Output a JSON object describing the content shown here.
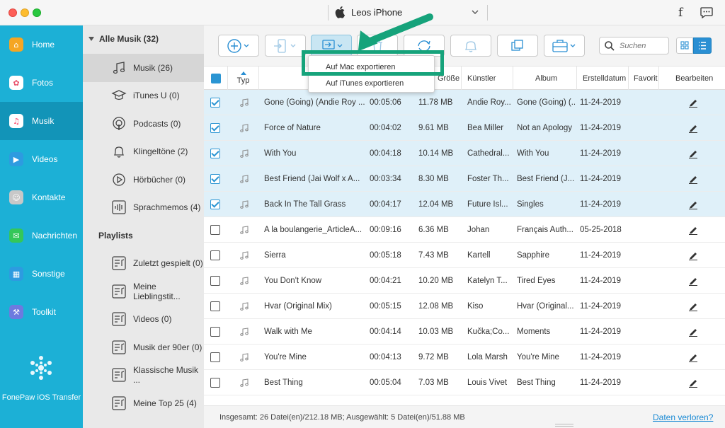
{
  "window": {
    "device_name": "Leos iPhone"
  },
  "sidebar": {
    "items": [
      {
        "label": "Home",
        "icon": "home-icon",
        "color": "#f5a623"
      },
      {
        "label": "Fotos",
        "icon": "photos-icon",
        "color": "#e94f6a"
      },
      {
        "label": "Musik",
        "icon": "music-icon",
        "color": "#fc3158",
        "active": true
      },
      {
        "label": "Videos",
        "icon": "videos-icon",
        "color": "#2d9be0"
      },
      {
        "label": "Kontakte",
        "icon": "contacts-icon",
        "color": "#b0b0b0"
      },
      {
        "label": "Nachrichten",
        "icon": "messages-icon",
        "color": "#34c759"
      },
      {
        "label": "Sonstige",
        "icon": "other-icon",
        "color": "#2d9be0"
      },
      {
        "label": "Toolkit",
        "icon": "toolkit-icon",
        "color": "#6d7adf"
      }
    ],
    "brand": "FonePaw iOS Transfer"
  },
  "categories": {
    "header": "Alle Musik (32)",
    "items": [
      {
        "label": "Musik (26)",
        "icon": "music-note-icon",
        "active": true
      },
      {
        "label": "iTunes U (0)",
        "icon": "itunes-u-icon"
      },
      {
        "label": "Podcasts (0)",
        "icon": "podcast-icon"
      },
      {
        "label": "Klingeltöne (2)",
        "icon": "bell-icon"
      },
      {
        "label": "Hörbücher (0)",
        "icon": "audiobook-icon"
      },
      {
        "label": "Sprachmemos (4)",
        "icon": "voice-memo-icon"
      }
    ],
    "playlists_header": "Playlists",
    "playlists": [
      {
        "label": "Zuletzt gespielt (0)"
      },
      {
        "label": "Meine Lieblingstit..."
      },
      {
        "label": "Videos (0)"
      },
      {
        "label": "Musik der 90er (0)"
      },
      {
        "label": "Klassische Musik ..."
      },
      {
        "label": "Meine Top 25 (4)"
      }
    ]
  },
  "toolbar": {
    "search_placeholder": "Suchen",
    "export_menu": [
      "Auf Mac exportieren",
      "Auf iTunes exportieren"
    ]
  },
  "table": {
    "columns": [
      "Typ",
      "Größe",
      "Künstler",
      "Album",
      "Erstelldatum",
      "Favorit",
      "Bearbeiten"
    ],
    "rows": [
      {
        "checked": true,
        "name": "Gone (Going) (Andie Roy ...",
        "duration": "00:05:06",
        "size": "11.78 MB",
        "artist": "Andie Roy...",
        "album": "Gone (Going) (...",
        "date": "11-24-2019"
      },
      {
        "checked": true,
        "name": "Force of Nature",
        "duration": "00:04:02",
        "size": "9.61 MB",
        "artist": "Bea Miller",
        "album": "Not an Apology",
        "date": "11-24-2019"
      },
      {
        "checked": true,
        "name": "With You",
        "duration": "00:04:18",
        "size": "10.14 MB",
        "artist": "Cathedral...",
        "album": "With You",
        "date": "11-24-2019"
      },
      {
        "checked": true,
        "name": "Best Friend (Jai Wolf x A...",
        "duration": "00:03:34",
        "size": "8.30 MB",
        "artist": "Foster Th...",
        "album": "Best Friend (J...",
        "date": "11-24-2019"
      },
      {
        "checked": true,
        "name": "Back In The Tall Grass",
        "duration": "00:04:17",
        "size": "12.04 MB",
        "artist": "Future Isl...",
        "album": "Singles",
        "date": "11-24-2019"
      },
      {
        "checked": false,
        "name": "A la boulangerie_ArticleA...",
        "duration": "00:09:16",
        "size": "6.36 MB",
        "artist": "Johan",
        "album": "Français Auth...",
        "date": "05-25-2018"
      },
      {
        "checked": false,
        "name": "Sierra",
        "duration": "00:05:18",
        "size": "7.43 MB",
        "artist": "Kartell",
        "album": "Sapphire",
        "date": "11-24-2019"
      },
      {
        "checked": false,
        "name": "You Don't Know",
        "duration": "00:04:21",
        "size": "10.20 MB",
        "artist": "Katelyn T...",
        "album": "Tired Eyes",
        "date": "11-24-2019"
      },
      {
        "checked": false,
        "name": "Hvar (Original Mix)",
        "duration": "00:05:15",
        "size": "12.08 MB",
        "artist": "Kiso",
        "album": "Hvar (Original...",
        "date": "11-24-2019"
      },
      {
        "checked": false,
        "name": "Walk with Me",
        "duration": "00:04:14",
        "size": "10.03 MB",
        "artist": "Kučka;Co...",
        "album": "Moments",
        "date": "11-24-2019"
      },
      {
        "checked": false,
        "name": "You're Mine",
        "duration": "00:04:13",
        "size": "9.72 MB",
        "artist": "Lola Marsh",
        "album": "You're Mine",
        "date": "11-24-2019"
      },
      {
        "checked": false,
        "name": "Best Thing",
        "duration": "00:05:04",
        "size": "7.03 MB",
        "artist": "Louis Vivet",
        "album": "Best Thing",
        "date": "11-24-2019"
      }
    ]
  },
  "status": {
    "summary": "Insgesamt: 26 Datei(en)/212.18 MB; Ausgewählt: 5 Datei(en)/51.88 MB",
    "link": "Daten verloren?"
  },
  "colors": {
    "accent": "#1cb0d6",
    "selection": "#dff0f9",
    "highlight": "#16a37b",
    "link": "#1a8ad4"
  }
}
